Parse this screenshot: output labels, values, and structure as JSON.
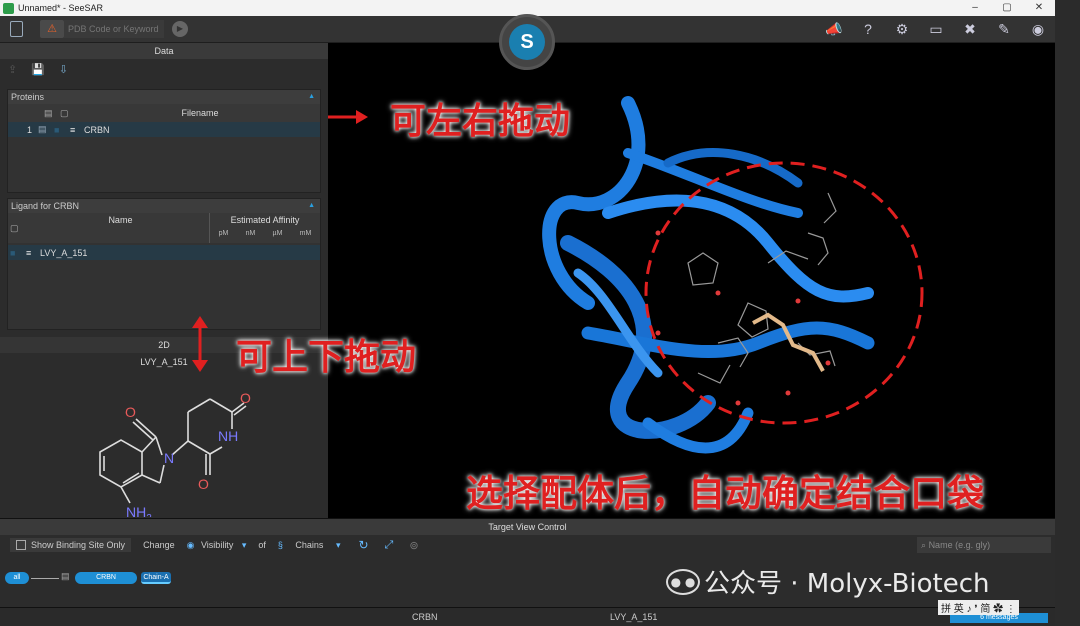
{
  "window": {
    "title": "Unnamed* - SeeSAR",
    "min": "–",
    "max": "▢",
    "close": "✕"
  },
  "toolbar": {
    "pdb_placeholder": "PDB Code or Keyword",
    "logo_letter": "S",
    "right_icons": [
      "megaphone-icon",
      "help-icon",
      "settings-icon",
      "monitor-icon",
      "tools-icon",
      "pin-icon",
      "eye-icon"
    ]
  },
  "data_panel": {
    "title": "Data",
    "proteins": {
      "title": "Proteins",
      "col_filename": "Filename",
      "rows": [
        {
          "index": "1",
          "filename": "CRBN"
        }
      ]
    },
    "ligands": {
      "title": "Ligand for CRBN",
      "col_name": "Name",
      "col_affinity": "Estimated Affinity",
      "units": [
        "pM",
        "nM",
        "µM",
        "mM"
      ],
      "rows": [
        {
          "name": "LVY_A_151"
        }
      ]
    }
  },
  "twod_panel": {
    "title": "2D",
    "ligand_name": "LVY_A_151",
    "atoms": {
      "o1": "O",
      "o2": "O",
      "o3": "O",
      "nh": "NH",
      "n": "N",
      "nh2": "NH",
      "nh2_sub": "2"
    }
  },
  "annotations": {
    "left_right": "可左右拖动",
    "up_down": "可上下拖动",
    "bottom": "选择配体后，自动确定结合口袋"
  },
  "target_view_control": {
    "title": "Target View Control",
    "show_binding_site": "Show Binding Site Only",
    "change": "Change",
    "visibility": "Visibility",
    "of": "of",
    "chains": "Chains",
    "name_placeholder": "Name (e.g. gly)",
    "tree": {
      "all": "all",
      "protein": "CRBN",
      "chain": "Chain-A"
    }
  },
  "status": {
    "protein": "CRBN",
    "ligand": "LVY_A_151",
    "messages": "6 messages"
  },
  "watermark": {
    "text": "公众号 · Molyx-Biotech"
  },
  "ime": {
    "text": "拼 英 ♪ ❜ 简 ✿ ⋮"
  },
  "colors": {
    "accent": "#1e8fd5",
    "annotation": "#e02020",
    "protein_ribbon": "#1f7de0"
  }
}
